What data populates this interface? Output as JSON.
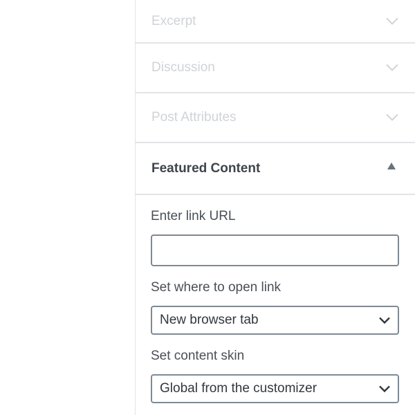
{
  "panels": {
    "excerpt": {
      "label": "Excerpt"
    },
    "discussion": {
      "label": "Discussion"
    },
    "post_attributes": {
      "label": "Post Attributes"
    }
  },
  "featured_content": {
    "title": "Featured Content",
    "link_url": {
      "label": "Enter link URL",
      "value": ""
    },
    "open_link": {
      "label": "Set where to open link",
      "selected": "New browser tab"
    },
    "content_skin": {
      "label": "Set content skin",
      "selected": "Global from the customizer"
    }
  },
  "colors": {
    "collapsed_title": "#d0d3d7",
    "border": "#e2e4e7",
    "input_border": "#7e8993",
    "text": "#32373c"
  },
  "icons": {
    "collapsed_panel": "chevron-down-icon",
    "expanded_panel": "caret-up-icon",
    "select": "chevron-down-icon"
  }
}
